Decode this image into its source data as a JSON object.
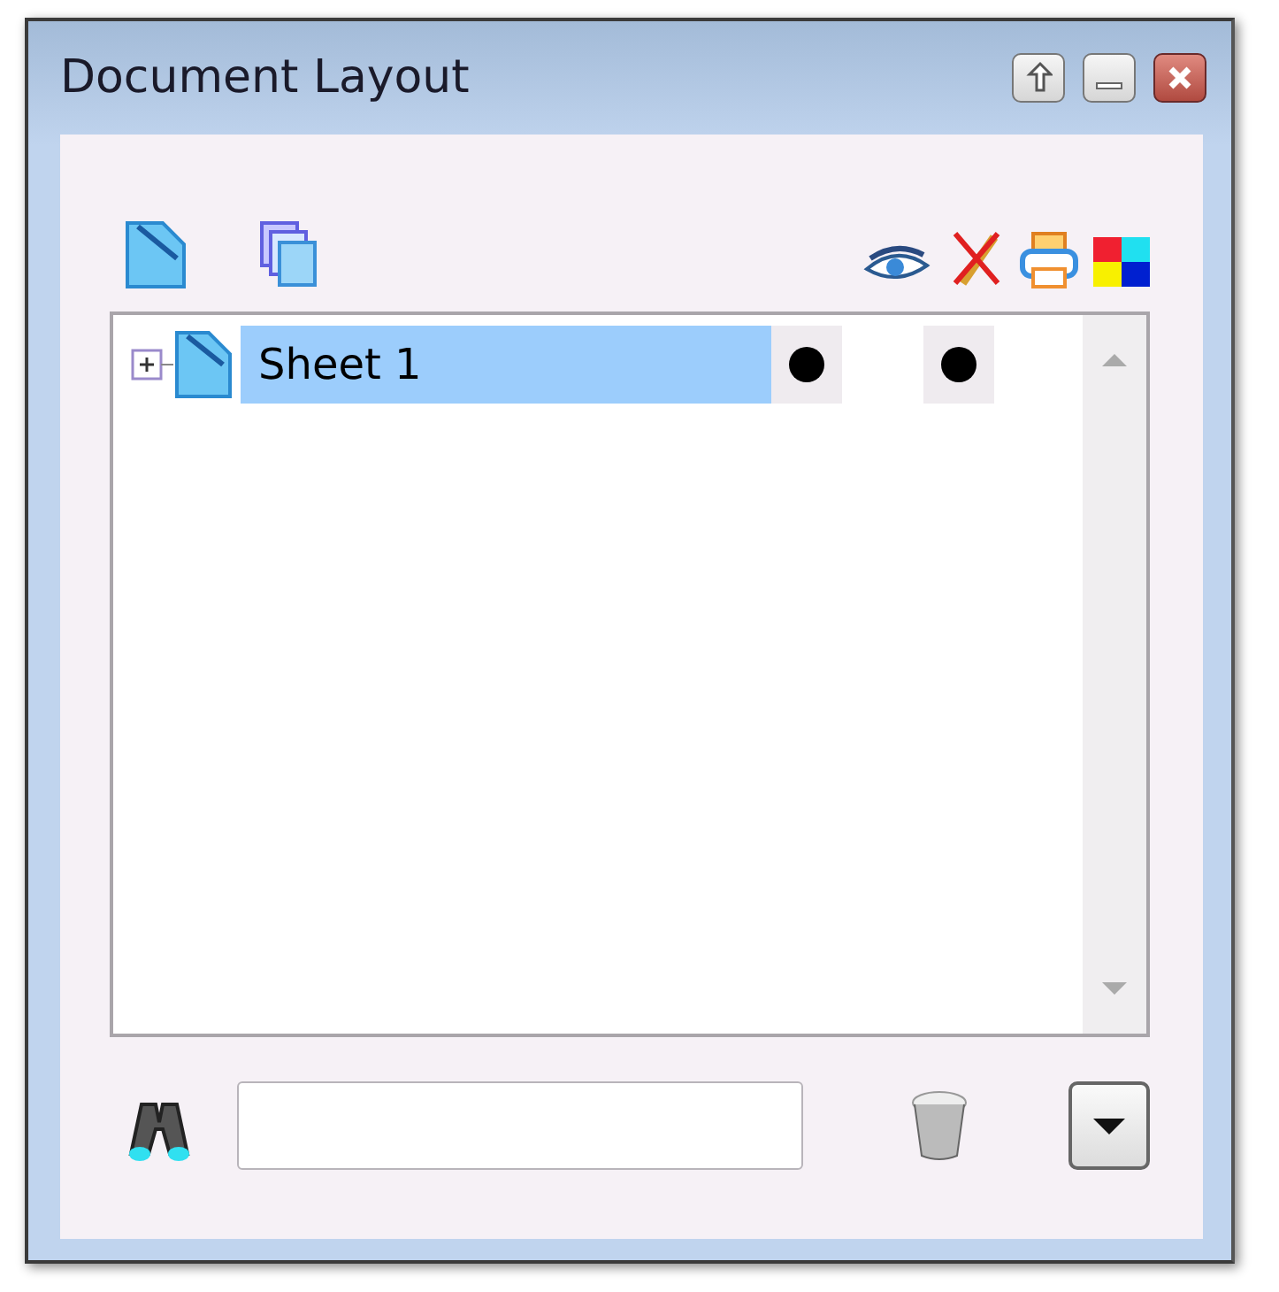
{
  "window": {
    "title": "Document Layout"
  },
  "tree": {
    "items": [
      {
        "label": "Sheet 1",
        "expanded": false,
        "selected": true,
        "visible": true,
        "printable": true
      }
    ]
  }
}
